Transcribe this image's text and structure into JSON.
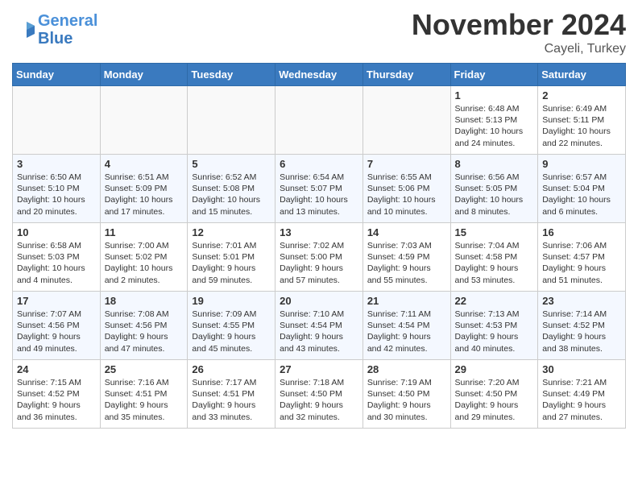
{
  "header": {
    "logo_line1": "General",
    "logo_line2": "Blue",
    "title": "November 2024",
    "subtitle": "Cayeli, Turkey"
  },
  "weekdays": [
    "Sunday",
    "Monday",
    "Tuesday",
    "Wednesday",
    "Thursday",
    "Friday",
    "Saturday"
  ],
  "weeks": [
    [
      {
        "day": "",
        "info": ""
      },
      {
        "day": "",
        "info": ""
      },
      {
        "day": "",
        "info": ""
      },
      {
        "day": "",
        "info": ""
      },
      {
        "day": "",
        "info": ""
      },
      {
        "day": "1",
        "info": "Sunrise: 6:48 AM\nSunset: 5:13 PM\nDaylight: 10 hours and 24 minutes."
      },
      {
        "day": "2",
        "info": "Sunrise: 6:49 AM\nSunset: 5:11 PM\nDaylight: 10 hours and 22 minutes."
      }
    ],
    [
      {
        "day": "3",
        "info": "Sunrise: 6:50 AM\nSunset: 5:10 PM\nDaylight: 10 hours and 20 minutes."
      },
      {
        "day": "4",
        "info": "Sunrise: 6:51 AM\nSunset: 5:09 PM\nDaylight: 10 hours and 17 minutes."
      },
      {
        "day": "5",
        "info": "Sunrise: 6:52 AM\nSunset: 5:08 PM\nDaylight: 10 hours and 15 minutes."
      },
      {
        "day": "6",
        "info": "Sunrise: 6:54 AM\nSunset: 5:07 PM\nDaylight: 10 hours and 13 minutes."
      },
      {
        "day": "7",
        "info": "Sunrise: 6:55 AM\nSunset: 5:06 PM\nDaylight: 10 hours and 10 minutes."
      },
      {
        "day": "8",
        "info": "Sunrise: 6:56 AM\nSunset: 5:05 PM\nDaylight: 10 hours and 8 minutes."
      },
      {
        "day": "9",
        "info": "Sunrise: 6:57 AM\nSunset: 5:04 PM\nDaylight: 10 hours and 6 minutes."
      }
    ],
    [
      {
        "day": "10",
        "info": "Sunrise: 6:58 AM\nSunset: 5:03 PM\nDaylight: 10 hours and 4 minutes."
      },
      {
        "day": "11",
        "info": "Sunrise: 7:00 AM\nSunset: 5:02 PM\nDaylight: 10 hours and 2 minutes."
      },
      {
        "day": "12",
        "info": "Sunrise: 7:01 AM\nSunset: 5:01 PM\nDaylight: 9 hours and 59 minutes."
      },
      {
        "day": "13",
        "info": "Sunrise: 7:02 AM\nSunset: 5:00 PM\nDaylight: 9 hours and 57 minutes."
      },
      {
        "day": "14",
        "info": "Sunrise: 7:03 AM\nSunset: 4:59 PM\nDaylight: 9 hours and 55 minutes."
      },
      {
        "day": "15",
        "info": "Sunrise: 7:04 AM\nSunset: 4:58 PM\nDaylight: 9 hours and 53 minutes."
      },
      {
        "day": "16",
        "info": "Sunrise: 7:06 AM\nSunset: 4:57 PM\nDaylight: 9 hours and 51 minutes."
      }
    ],
    [
      {
        "day": "17",
        "info": "Sunrise: 7:07 AM\nSunset: 4:56 PM\nDaylight: 9 hours and 49 minutes."
      },
      {
        "day": "18",
        "info": "Sunrise: 7:08 AM\nSunset: 4:56 PM\nDaylight: 9 hours and 47 minutes."
      },
      {
        "day": "19",
        "info": "Sunrise: 7:09 AM\nSunset: 4:55 PM\nDaylight: 9 hours and 45 minutes."
      },
      {
        "day": "20",
        "info": "Sunrise: 7:10 AM\nSunset: 4:54 PM\nDaylight: 9 hours and 43 minutes."
      },
      {
        "day": "21",
        "info": "Sunrise: 7:11 AM\nSunset: 4:54 PM\nDaylight: 9 hours and 42 minutes."
      },
      {
        "day": "22",
        "info": "Sunrise: 7:13 AM\nSunset: 4:53 PM\nDaylight: 9 hours and 40 minutes."
      },
      {
        "day": "23",
        "info": "Sunrise: 7:14 AM\nSunset: 4:52 PM\nDaylight: 9 hours and 38 minutes."
      }
    ],
    [
      {
        "day": "24",
        "info": "Sunrise: 7:15 AM\nSunset: 4:52 PM\nDaylight: 9 hours and 36 minutes."
      },
      {
        "day": "25",
        "info": "Sunrise: 7:16 AM\nSunset: 4:51 PM\nDaylight: 9 hours and 35 minutes."
      },
      {
        "day": "26",
        "info": "Sunrise: 7:17 AM\nSunset: 4:51 PM\nDaylight: 9 hours and 33 minutes."
      },
      {
        "day": "27",
        "info": "Sunrise: 7:18 AM\nSunset: 4:50 PM\nDaylight: 9 hours and 32 minutes."
      },
      {
        "day": "28",
        "info": "Sunrise: 7:19 AM\nSunset: 4:50 PM\nDaylight: 9 hours and 30 minutes."
      },
      {
        "day": "29",
        "info": "Sunrise: 7:20 AM\nSunset: 4:50 PM\nDaylight: 9 hours and 29 minutes."
      },
      {
        "day": "30",
        "info": "Sunrise: 7:21 AM\nSunset: 4:49 PM\nDaylight: 9 hours and 27 minutes."
      }
    ]
  ]
}
